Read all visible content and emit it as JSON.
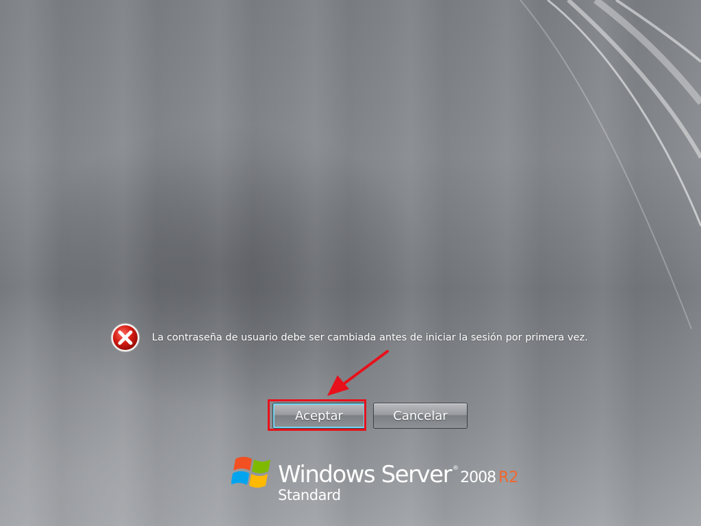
{
  "message": {
    "icon": "error-icon",
    "text": "La contraseña de usuario debe ser cambiada antes de iniciar la sesión por primera vez."
  },
  "buttons": {
    "accept_label": "Aceptar",
    "cancel_label": "Cancelar"
  },
  "branding": {
    "logo_icon": "windows-flag-icon",
    "name": "Windows Server",
    "registered_mark": "®",
    "version": "2008",
    "release": "R2",
    "edition": "Standard"
  },
  "annotation": {
    "highlight_color": "#e8101a",
    "focus_ring_color": "#6fd7f1",
    "release_color": "#f2662a"
  }
}
